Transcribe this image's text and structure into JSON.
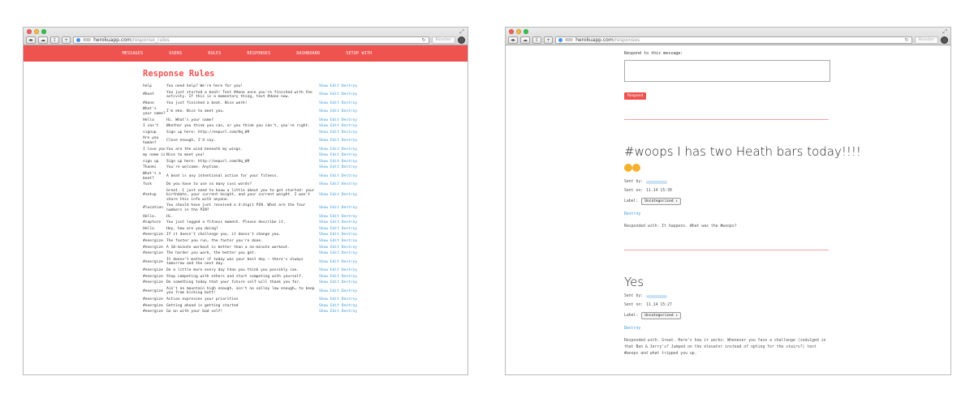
{
  "left": {
    "browser": {
      "domain": "herokuapp.com",
      "path": "/response_rules",
      "reader": "Reader"
    },
    "nav": [
      "MESSAGES",
      "USERS",
      "RULES",
      "RESPONSES",
      "DASHBOARD",
      "SETUP WITH"
    ],
    "title": "Response Rules",
    "actions": {
      "show": "Show",
      "edit": "Edit",
      "destroy": "Destroy"
    },
    "rules": [
      {
        "k": "help",
        "v": "You need help? We're here for you!"
      },
      {
        "k": "#beat",
        "v": "You just started a beat! Text #done once you're finished with the activity. If this is a momentary thing, text #done now."
      },
      {
        "k": "#done",
        "v": "You just finished a beat. Nice work!"
      },
      {
        "k": "What's your name?",
        "v": "I'm eko. Nice to meet you."
      },
      {
        "k": "Hello",
        "v": "Hi. What's your name?"
      },
      {
        "k": "I can't",
        "v": "Whether you think you can, or you think you can't, you're right."
      },
      {
        "k": "signup",
        "v": "Sign up here: http://eepurl.com/Hq_W9"
      },
      {
        "k": "Are you human?",
        "v": "Close enough, I'd say."
      },
      {
        "k": "I love you",
        "v": "You are the wind beneath my wings."
      },
      {
        "k": "my name is",
        "v": "Nice to meet you!"
      },
      {
        "k": "sign up",
        "v": "Sign up here: http://eepurl.com/Hq_W9"
      },
      {
        "k": "Thanks",
        "v": "You're welcome. Anytime."
      },
      {
        "k": "What's a beat?",
        "v": "A beat is any intentional action for your fitness."
      },
      {
        "k": "fuck",
        "v": "Do you have to use so many cuss words?"
      },
      {
        "k": "#setup",
        "v": "Great. I just need to know a little about you to get started: your birthdate, your current height, and your current weight. I won't share this info with anyone."
      },
      {
        "k": "#location",
        "v": "You should have just received a 4-digit PIN. What are the four numbers in the PIN?"
      },
      {
        "k": "Hello.",
        "v": "Hi."
      },
      {
        "k": "#capture",
        "v": "You just logged a fitness moment. Please describe it."
      },
      {
        "k": "Hello",
        "v": "Hey, how are you doing?"
      },
      {
        "k": "#energize",
        "v": "If it doesn't challenge you, it doesn't change you."
      },
      {
        "k": "#energize",
        "v": "The faster you run, the faster you're done."
      },
      {
        "k": "#energize",
        "v": "A 10-minute workout is better than a no-minute workout."
      },
      {
        "k": "#energize",
        "v": "The harder you work, the better you get."
      },
      {
        "k": "#energize",
        "v": "It doesn't matter if today was your best day — there's always tomorrow and the next day."
      },
      {
        "k": "#energize",
        "v": "Do a little more every day than you think you possibly can."
      },
      {
        "k": "#energize",
        "v": "Stop competing with others and start competing with yourself."
      },
      {
        "k": "#energize",
        "v": "Do something today that your future self will thank you for."
      },
      {
        "k": "#energize",
        "v": "Ain't no mountain high enough, ain't no valley low enough… to keep you from kicking butt!"
      },
      {
        "k": "#energize",
        "v": "Action expresses your priorities"
      },
      {
        "k": "#energize",
        "v": "Getting ahead is getting started"
      },
      {
        "k": "#energize",
        "v": "Go on with your bad self!"
      }
    ]
  },
  "right": {
    "browser": {
      "domain": "herokuapp.com",
      "path": "/responses",
      "reader": "Reader"
    },
    "respond_label": "Respond to this message:",
    "respond_button": "Respond",
    "labels": {
      "sent_by": "Sent by:",
      "sent_on": "Sent on:",
      "label": "Label:",
      "destroy": "Destroy",
      "responded_with": "Responded with:"
    },
    "messages": [
      {
        "title": "#woops I has two Heath bars today!!!!",
        "sent_on": "11.14 15:30",
        "label": "Uncategorized",
        "response": "It happens. What was the #woops?"
      },
      {
        "title": "Yes",
        "sent_on": "11.14 15:27",
        "label": "Uncategorized",
        "response": "Great. Here's how it works: Whenever you face a challenge (indulged in that Ben & Jerry's? Jumped on the elevator instead of opting for the stairs?) text #woops and what tripped you up."
      }
    ]
  }
}
